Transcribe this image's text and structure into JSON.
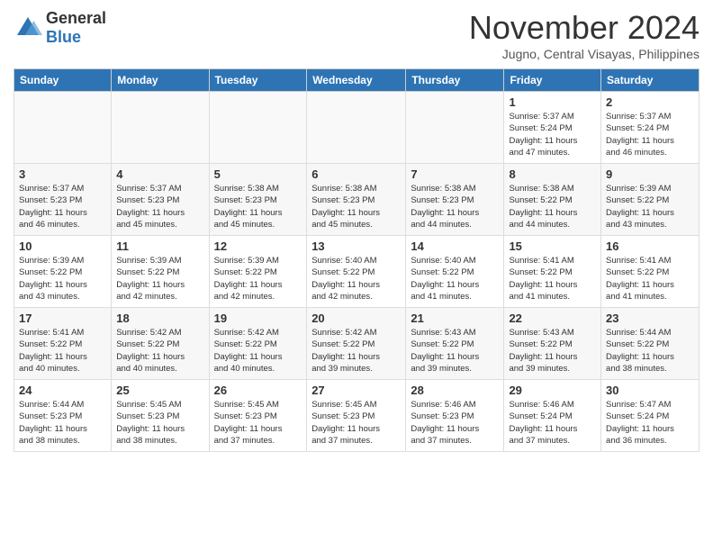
{
  "header": {
    "logo": {
      "general": "General",
      "blue": "Blue"
    },
    "title": "November 2024",
    "location": "Jugno, Central Visayas, Philippines"
  },
  "calendar": {
    "days_of_week": [
      "Sunday",
      "Monday",
      "Tuesday",
      "Wednesday",
      "Thursday",
      "Friday",
      "Saturday"
    ],
    "weeks": [
      [
        {
          "day": "",
          "info": "",
          "empty": true
        },
        {
          "day": "",
          "info": "",
          "empty": true
        },
        {
          "day": "",
          "info": "",
          "empty": true
        },
        {
          "day": "",
          "info": "",
          "empty": true
        },
        {
          "day": "",
          "info": "",
          "empty": true
        },
        {
          "day": "1",
          "info": "Sunrise: 5:37 AM\nSunset: 5:24 PM\nDaylight: 11 hours\nand 47 minutes."
        },
        {
          "day": "2",
          "info": "Sunrise: 5:37 AM\nSunset: 5:24 PM\nDaylight: 11 hours\nand 46 minutes."
        }
      ],
      [
        {
          "day": "3",
          "info": "Sunrise: 5:37 AM\nSunset: 5:23 PM\nDaylight: 11 hours\nand 46 minutes."
        },
        {
          "day": "4",
          "info": "Sunrise: 5:37 AM\nSunset: 5:23 PM\nDaylight: 11 hours\nand 45 minutes."
        },
        {
          "day": "5",
          "info": "Sunrise: 5:38 AM\nSunset: 5:23 PM\nDaylight: 11 hours\nand 45 minutes."
        },
        {
          "day": "6",
          "info": "Sunrise: 5:38 AM\nSunset: 5:23 PM\nDaylight: 11 hours\nand 45 minutes."
        },
        {
          "day": "7",
          "info": "Sunrise: 5:38 AM\nSunset: 5:23 PM\nDaylight: 11 hours\nand 44 minutes."
        },
        {
          "day": "8",
          "info": "Sunrise: 5:38 AM\nSunset: 5:22 PM\nDaylight: 11 hours\nand 44 minutes."
        },
        {
          "day": "9",
          "info": "Sunrise: 5:39 AM\nSunset: 5:22 PM\nDaylight: 11 hours\nand 43 minutes."
        }
      ],
      [
        {
          "day": "10",
          "info": "Sunrise: 5:39 AM\nSunset: 5:22 PM\nDaylight: 11 hours\nand 43 minutes."
        },
        {
          "day": "11",
          "info": "Sunrise: 5:39 AM\nSunset: 5:22 PM\nDaylight: 11 hours\nand 42 minutes."
        },
        {
          "day": "12",
          "info": "Sunrise: 5:39 AM\nSunset: 5:22 PM\nDaylight: 11 hours\nand 42 minutes."
        },
        {
          "day": "13",
          "info": "Sunrise: 5:40 AM\nSunset: 5:22 PM\nDaylight: 11 hours\nand 42 minutes."
        },
        {
          "day": "14",
          "info": "Sunrise: 5:40 AM\nSunset: 5:22 PM\nDaylight: 11 hours\nand 41 minutes."
        },
        {
          "day": "15",
          "info": "Sunrise: 5:41 AM\nSunset: 5:22 PM\nDaylight: 11 hours\nand 41 minutes."
        },
        {
          "day": "16",
          "info": "Sunrise: 5:41 AM\nSunset: 5:22 PM\nDaylight: 11 hours\nand 41 minutes."
        }
      ],
      [
        {
          "day": "17",
          "info": "Sunrise: 5:41 AM\nSunset: 5:22 PM\nDaylight: 11 hours\nand 40 minutes."
        },
        {
          "day": "18",
          "info": "Sunrise: 5:42 AM\nSunset: 5:22 PM\nDaylight: 11 hours\nand 40 minutes."
        },
        {
          "day": "19",
          "info": "Sunrise: 5:42 AM\nSunset: 5:22 PM\nDaylight: 11 hours\nand 40 minutes."
        },
        {
          "day": "20",
          "info": "Sunrise: 5:42 AM\nSunset: 5:22 PM\nDaylight: 11 hours\nand 39 minutes."
        },
        {
          "day": "21",
          "info": "Sunrise: 5:43 AM\nSunset: 5:22 PM\nDaylight: 11 hours\nand 39 minutes."
        },
        {
          "day": "22",
          "info": "Sunrise: 5:43 AM\nSunset: 5:22 PM\nDaylight: 11 hours\nand 39 minutes."
        },
        {
          "day": "23",
          "info": "Sunrise: 5:44 AM\nSunset: 5:22 PM\nDaylight: 11 hours\nand 38 minutes."
        }
      ],
      [
        {
          "day": "24",
          "info": "Sunrise: 5:44 AM\nSunset: 5:23 PM\nDaylight: 11 hours\nand 38 minutes."
        },
        {
          "day": "25",
          "info": "Sunrise: 5:45 AM\nSunset: 5:23 PM\nDaylight: 11 hours\nand 38 minutes."
        },
        {
          "day": "26",
          "info": "Sunrise: 5:45 AM\nSunset: 5:23 PM\nDaylight: 11 hours\nand 37 minutes."
        },
        {
          "day": "27",
          "info": "Sunrise: 5:45 AM\nSunset: 5:23 PM\nDaylight: 11 hours\nand 37 minutes."
        },
        {
          "day": "28",
          "info": "Sunrise: 5:46 AM\nSunset: 5:23 PM\nDaylight: 11 hours\nand 37 minutes."
        },
        {
          "day": "29",
          "info": "Sunrise: 5:46 AM\nSunset: 5:24 PM\nDaylight: 11 hours\nand 37 minutes."
        },
        {
          "day": "30",
          "info": "Sunrise: 5:47 AM\nSunset: 5:24 PM\nDaylight: 11 hours\nand 36 minutes."
        }
      ]
    ]
  }
}
